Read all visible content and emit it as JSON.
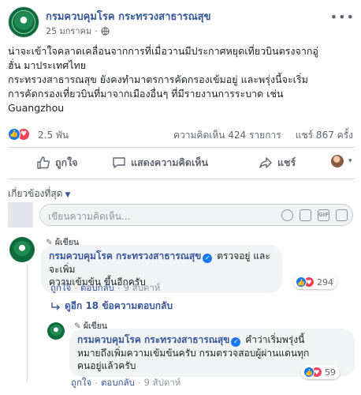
{
  "post": {
    "page_name": "กรมควบคุมโรค กระทรวงสาธารณสุข",
    "date": "25 มกราคม",
    "meta_sep": "·",
    "more": "•••",
    "body_lines": [
      "น่าจะเข้าใจคลาดเคลื่อนจากการที่เมื่อวานมีประกาศหยุดเที่ยวบินตรงจากอู่",
      "ฮั่น มาประเทศไทย",
      "กระทรวงสาธารณสุข ยังคงทำมาตรการคัดกรองเข้มอยู่ และพรุ่งนี้จะเริ่ม",
      "การคัดกรองเที่ยวบินที่มาจากเมืองอื่นๆ ที่มีรายงานการระบาด เช่น",
      "Guangzhou"
    ],
    "reaction_count": "2.5 พัน",
    "comment_count": "ความคิดเห็น 424 รายการ",
    "share_count": "แชร์ 867 ครั้ง"
  },
  "actions": {
    "like": "ถูกใจ",
    "comment": "แสดงความคิดเห็น",
    "share": "แชร์"
  },
  "sort_label": "เกี่ยวข้องที่สุด",
  "composer": {
    "placeholder": "เขียนความคิดเห็น..."
  },
  "comments": [
    {
      "badge": "ผู้เขียน",
      "author": "กรมควบคุมโรค กระทรวงสาธารณสุข",
      "text_inline": "ตรวจอยู่ และจะเพิ่ม",
      "text_line2": "ความเข้มข้น ขึ้นอีกครับ",
      "reaction_count": "294",
      "reply_label": "ตอบกลับ",
      "time": "9 สัปดาห์",
      "like_label": "ถูกใจ",
      "sep": "·"
    },
    {
      "badge": "ผู้เขียน",
      "author": "กรมควบคุมโรค กระทรวงสาธารณสุข",
      "text_inline": "คำว่าเริ่มพรุ่งนี้",
      "text_line2": "หมายถึงเพิ่มความเข้มข้นครับ กรมตรวจสอบผู้ผ่านแดนทุก",
      "text_line3": "คนอยู่แล้วครับ",
      "reaction_count": "59",
      "reply_label": "ตอบกลับ",
      "time": "9 สัปดาห์",
      "like_label": "ถูกใจ",
      "sep": "·"
    }
  ],
  "view_replies": "ดูอีก 18 ข้อความตอบกลับ",
  "colors": {
    "link": "#385898",
    "like": "#1877f2",
    "love": "#f33e58",
    "avatar_green": "#0d6b3e"
  }
}
